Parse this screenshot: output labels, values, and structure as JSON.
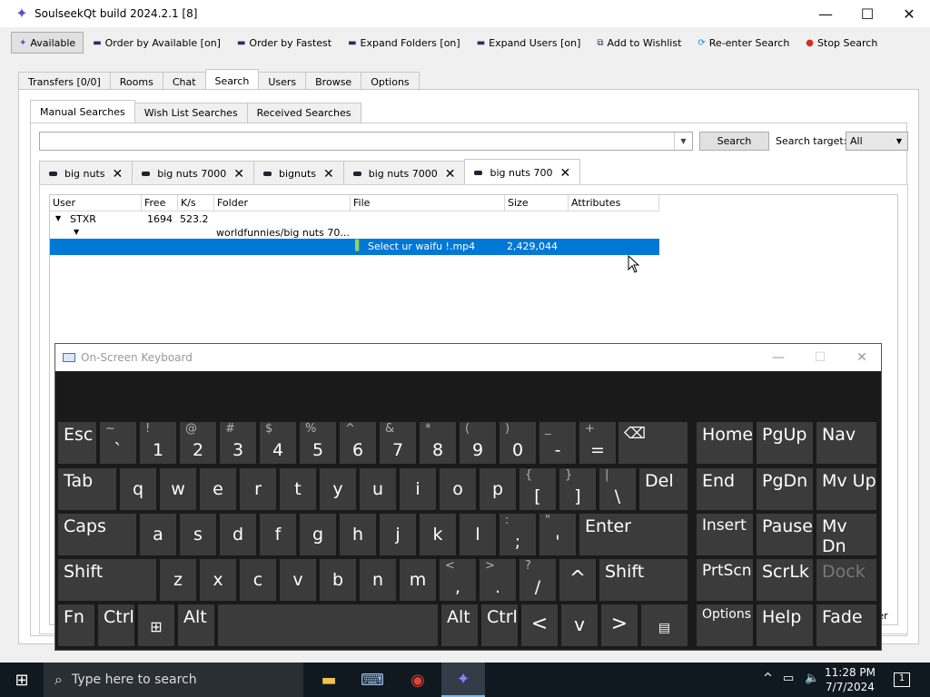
{
  "window": {
    "title": "SoulseekQt build 2024.2.1 [8]",
    "minimize": "—",
    "maximize": "☐",
    "close": "✕"
  },
  "toolbar": [
    {
      "label": "Available",
      "icon": "soulseek-bird-icon"
    },
    {
      "label": "Order by Available [on]",
      "icon": "sort-icon"
    },
    {
      "label": "Order by Fastest",
      "icon": "sort-icon"
    },
    {
      "label": "Expand Folders [on]",
      "icon": "expand-icon"
    },
    {
      "label": "Expand Users [on]",
      "icon": "expand-icon"
    },
    {
      "label": "Add to Wishlist",
      "icon": "binoculars-icon"
    },
    {
      "label": "Re-enter Search",
      "icon": "refresh-icon"
    },
    {
      "label": "Stop Search",
      "icon": "stop-icon"
    }
  ],
  "main_tabs": [
    "Transfers [0/0]",
    "Rooms",
    "Chat",
    "Search",
    "Users",
    "Browse",
    "Options"
  ],
  "main_tab_active": "Search",
  "sub_tabs": [
    "Manual Searches",
    "Wish List Searches",
    "Received Searches"
  ],
  "search": {
    "value": "",
    "button": "Search",
    "target_label": "Search target:",
    "target_value": "All"
  },
  "result_tabs": [
    "big nuts",
    "big nuts 7000",
    "bignuts",
    "big nuts 7000",
    "big nuts 700"
  ],
  "columns": [
    "User",
    "Free",
    "K/s",
    "Folder",
    "File",
    "Size",
    "Attributes"
  ],
  "rows": {
    "user": "STXR",
    "free": "1694",
    "speed": "523.2",
    "folder": "worldfunnies/big nuts 70...",
    "file": "Select ur waifu !.mp4",
    "size": "2,429,044"
  },
  "bottom_partial": "ter",
  "osk": {
    "title": "On-Screen Keyboard",
    "row1": [
      [
        "~",
        "`"
      ],
      [
        "!",
        "1"
      ],
      [
        "@",
        "2"
      ],
      [
        "#",
        "3"
      ],
      [
        "$",
        "4"
      ],
      [
        "%",
        "5"
      ],
      [
        "^",
        "6"
      ],
      [
        "&",
        "7"
      ],
      [
        "*",
        "8"
      ],
      [
        "(",
        "9"
      ],
      [
        ")",
        "0"
      ],
      [
        "_",
        "-"
      ],
      [
        "+",
        "="
      ]
    ],
    "esc": "Esc",
    "backspace": "⌫",
    "row2": [
      "q",
      "w",
      "e",
      "r",
      "t",
      "y",
      "u",
      "i",
      "o",
      "p"
    ],
    "row2_sym": [
      [
        "{",
        "["
      ],
      [
        "}",
        "]"
      ],
      [
        "|",
        "\\"
      ]
    ],
    "tab": "Tab",
    "del": "Del",
    "caps": "Caps",
    "row3": [
      "a",
      "s",
      "d",
      "f",
      "g",
      "h",
      "j",
      "k",
      "l"
    ],
    "row3_sym": [
      [
        ":",
        ";"
      ],
      [
        "\"",
        "'"
      ]
    ],
    "enter": "Enter",
    "shift": "Shift",
    "row4": [
      "z",
      "x",
      "c",
      "v",
      "b",
      "n",
      "m"
    ],
    "row4_sym": [
      [
        "<",
        ","
      ],
      [
        ">",
        "."
      ],
      [
        "?",
        "/"
      ]
    ],
    "up": "^",
    "fn": "Fn",
    "ctrl": "Ctrl",
    "alt": "Alt",
    "win": "⊞",
    "left": "<",
    "down": "v",
    "right": ">",
    "menu": "▤",
    "nav": [
      "Home",
      "PgUp",
      "Nav",
      "End",
      "PgDn",
      "Mv Up",
      "Insert",
      "Pause",
      "Mv Dn",
      "PrtScn",
      "ScrLk",
      "Dock",
      "Options",
      "Help",
      "Fade"
    ]
  },
  "taskbar": {
    "search_placeholder": "Type here to search",
    "time": "11:28 PM",
    "date": "7/7/2024",
    "notif": "1"
  }
}
